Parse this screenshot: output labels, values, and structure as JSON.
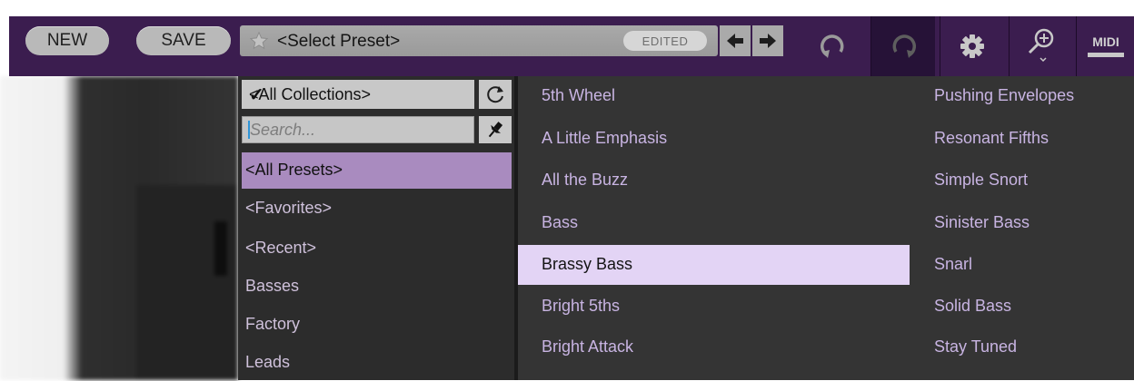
{
  "toolbar": {
    "new_label": "NEW",
    "save_label": "SAVE",
    "preset_name": "<Select Preset>",
    "edited_label": "EDITED",
    "midi_label": "MIDI",
    "icons": [
      "star-icon",
      "prev-arrow-icon",
      "next-arrow-icon",
      "undo-icon",
      "redo-icon",
      "gear-icon",
      "zoom-icon",
      "midi-icon"
    ]
  },
  "collections": {
    "selected": "<All Collections>",
    "search_placeholder": "Search...",
    "items": [
      {
        "label": "<All Presets>",
        "selected": true
      },
      {
        "label": "<Favorites>",
        "selected": false
      },
      {
        "label": "<Recent>",
        "selected": false
      },
      {
        "label": "Basses",
        "selected": false
      },
      {
        "label": "Factory",
        "selected": false
      },
      {
        "label": "Leads",
        "selected": false
      }
    ]
  },
  "presets": {
    "column1": [
      "5th Wheel",
      "A Little Emphasis",
      "All the Buzz",
      "Bass",
      "Brassy Bass",
      "Bright 5ths",
      "Bright Attack"
    ],
    "column2": [
      "Pushing Envelopes",
      "Resonant Fifths",
      "Simple Snort",
      "Sinister Bass",
      "Snarl",
      "Solid Bass",
      "Stay Tuned"
    ],
    "highlighted": "Brassy Bass"
  },
  "colors": {
    "toolbar_bg": "#3b1d4f",
    "selected_collection": "#a98bbf",
    "highlighted_preset": "#e3d4f5",
    "preset_text": "#c8b4e2"
  }
}
